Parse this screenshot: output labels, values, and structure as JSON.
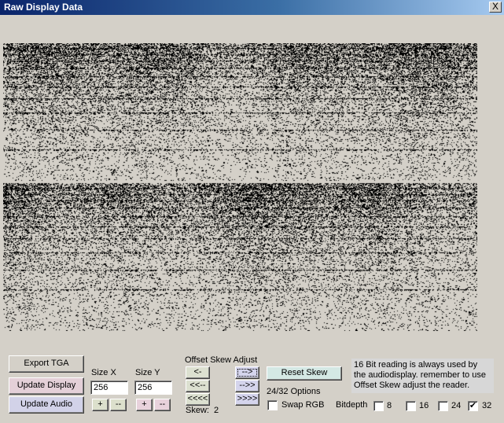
{
  "window": {
    "title": "Raw Display Data",
    "close_glyph": "X"
  },
  "display": {
    "ink_color": "#000000",
    "background": "#d4d0c8"
  },
  "buttons": {
    "export_tga": "Export TGA",
    "update_display": "Update Display",
    "update_audio": "Update Audio",
    "reset_skew": "Reset Skew"
  },
  "size_x": {
    "label": "Size X",
    "value": "256",
    "plus": "+",
    "minus": "--"
  },
  "size_y": {
    "label": "Size Y",
    "value": "256",
    "plus": "+",
    "minus": "--"
  },
  "skew": {
    "heading": "Offset Skew Adjust",
    "left_1": "<-",
    "left_2": "<<--",
    "left_3": "<<<<",
    "right_1": "-->",
    "right_2": "-->>",
    "right_3": ">>>>",
    "label": "Skew:",
    "value": "2"
  },
  "options": {
    "heading": "24/32 Options",
    "swap_rgb_label": "Swap RGB",
    "swap_rgb_checked": false
  },
  "bitdepth": {
    "label": "Bitdepth",
    "options": [
      {
        "label": "8",
        "checked": false
      },
      {
        "label": "16",
        "checked": false
      },
      {
        "label": "24",
        "checked": false
      },
      {
        "label": "32",
        "checked": true
      }
    ]
  },
  "note": "16 Bit reading is always used by the audiodisplay. remember to use Offset Skew adjust the reader.",
  "colors": {
    "update_display_bg": "#e4d0d8",
    "update_audio_bg": "#d2d2e8",
    "size_x_stepper_bg": "#dce0cc",
    "size_y_stepper_bg": "#e8d2dc",
    "skew_left_bg": "#dce0d0",
    "skew_right_bg": "#d4d4ec",
    "reset_skew_bg": "#d4e8e4"
  }
}
